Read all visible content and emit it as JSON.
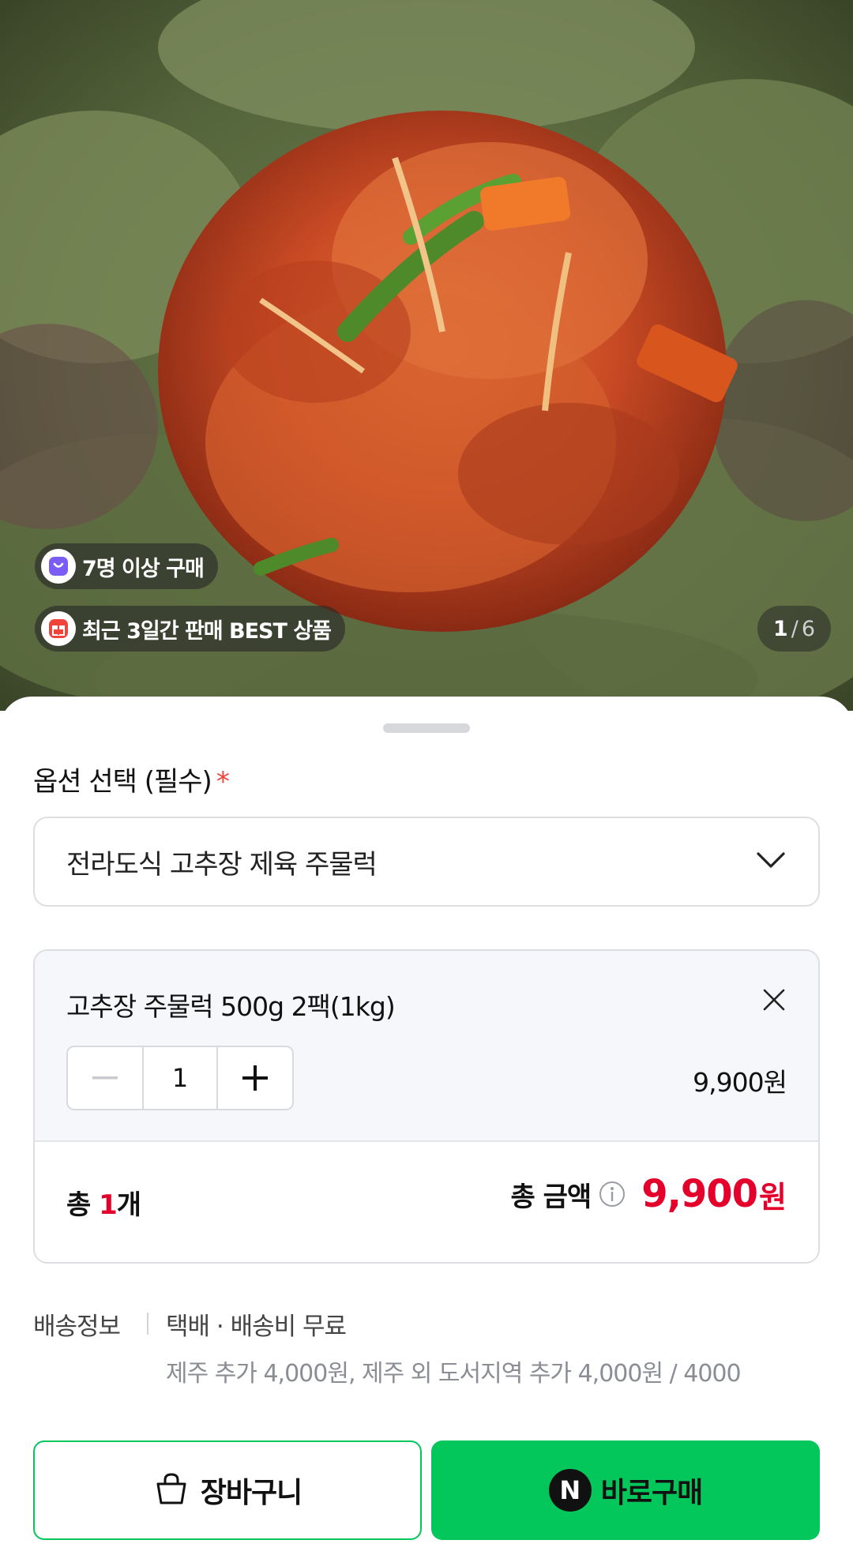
{
  "hero": {
    "image_alt": "food-photo",
    "badges": [
      {
        "label": "7명 이상 구매",
        "icon": "shopping-bag-icon",
        "icon_color": "#7b5cf5"
      },
      {
        "label": "최근 3일간 판매 BEST 상품",
        "icon": "gift-icon",
        "icon_color": "#f0443a"
      }
    ],
    "counter": {
      "current": "1",
      "separator": "/",
      "total": "6"
    }
  },
  "option": {
    "label": "옵션 선택 (필수)",
    "required_mark": "*",
    "selected": "전라도식 고추장 제육 주물럭"
  },
  "item": {
    "name": "고추장 주물럭 500g 2팩(1kg)",
    "quantity": "1",
    "price": "9,900원"
  },
  "total": {
    "count_prefix": "총 ",
    "count": "1",
    "count_suffix": "개",
    "amount_label": "총 금액",
    "amount_value": "9,900",
    "amount_unit": "원"
  },
  "shipping": {
    "label": "배송정보",
    "main": "택배 · 배송비 무료",
    "sub": "제주 추가 4,000원, 제주 외 도서지역 추가 4,000원 / 4000"
  },
  "buttons": {
    "cart_label": "장바구니",
    "buy_logo": "N",
    "buy_label": "바로구매"
  },
  "colors": {
    "accent_green": "#03c75a",
    "price_red": "#e4002b",
    "required_red": "#f0443a"
  }
}
